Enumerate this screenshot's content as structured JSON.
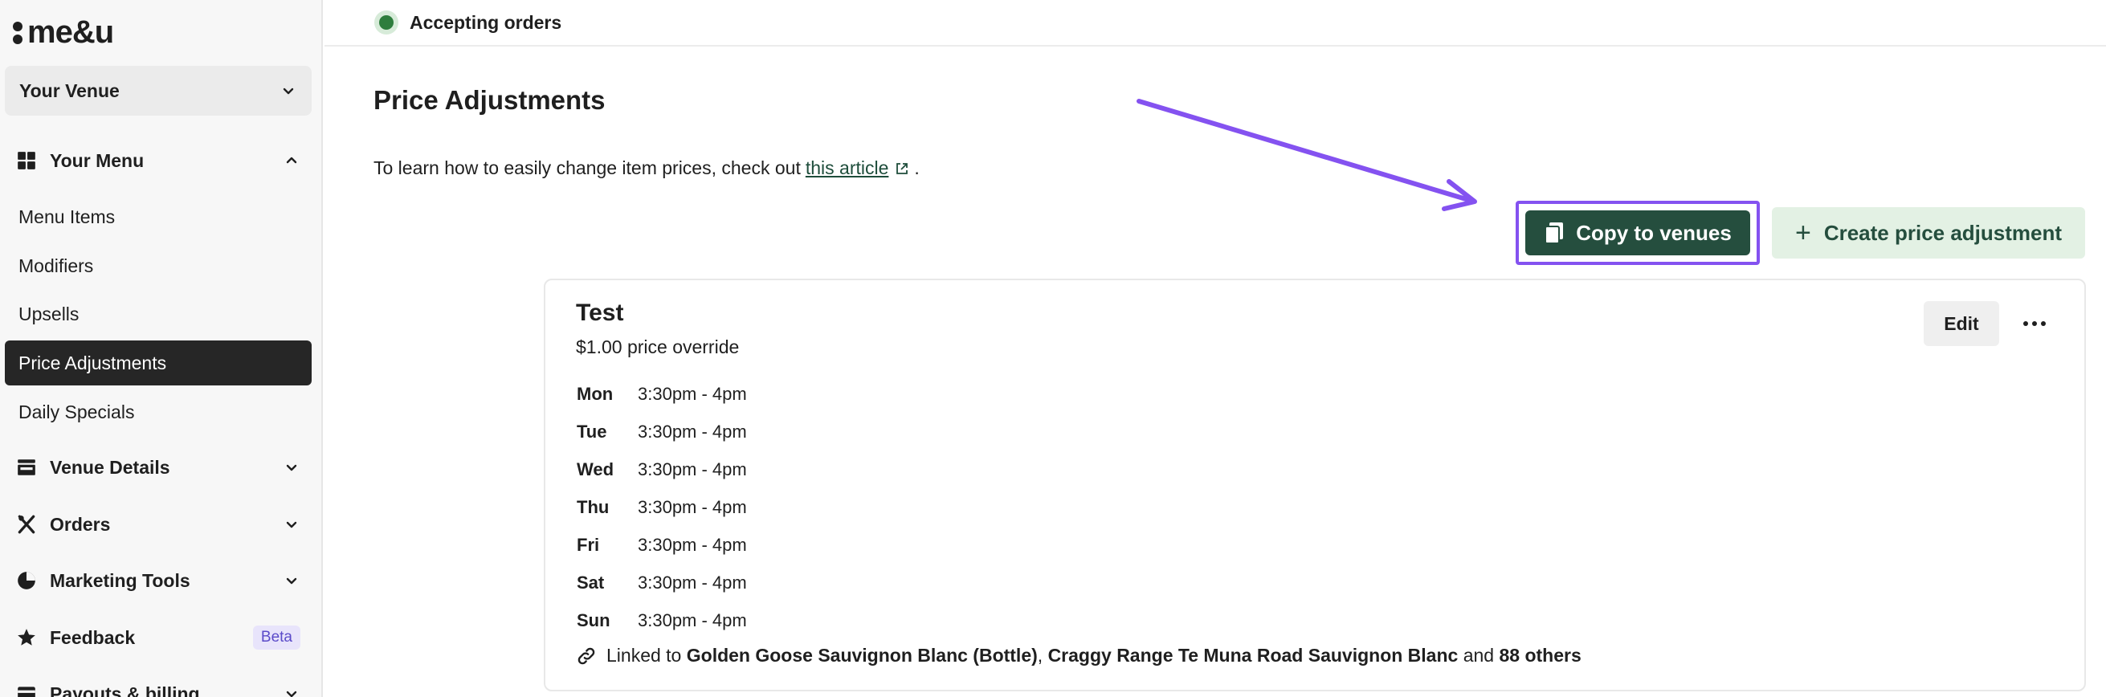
{
  "app": {
    "logo_text": "me&u"
  },
  "sidebar": {
    "venue_select": "Your Venue",
    "your_menu": "Your Menu",
    "menu_items": [
      {
        "label": "Menu Items"
      },
      {
        "label": "Modifiers"
      },
      {
        "label": "Upsells"
      },
      {
        "label": "Price Adjustments",
        "active": true
      },
      {
        "label": "Daily Specials"
      }
    ],
    "sections": [
      {
        "label": "Venue Details",
        "icon": "storefront-icon"
      },
      {
        "label": "Orders",
        "icon": "cutlery-icon"
      },
      {
        "label": "Marketing Tools",
        "icon": "pie-chart-icon"
      },
      {
        "label": "Feedback",
        "icon": "star-icon",
        "badge": "Beta"
      },
      {
        "label": "Payouts & billing",
        "icon": "card-icon"
      }
    ]
  },
  "status": {
    "label": "Accepting orders",
    "color": "#2e7d3d"
  },
  "page": {
    "title": "Price Adjustments",
    "help_prefix": "To learn how to easily change item prices, check out",
    "help_link": "this article",
    "help_suffix": "."
  },
  "actions": {
    "copy_label": "Copy to venues",
    "create_label": "Create price adjustment"
  },
  "adjustment": {
    "title": "Test",
    "subtitle": "$1.00 price override",
    "edit_label": "Edit",
    "schedule": [
      {
        "day": "Mon",
        "time": "3:30pm - 4pm"
      },
      {
        "day": "Tue",
        "time": "3:30pm - 4pm"
      },
      {
        "day": "Wed",
        "time": "3:30pm - 4pm"
      },
      {
        "day": "Thu",
        "time": "3:30pm - 4pm"
      },
      {
        "day": "Fri",
        "time": "3:30pm - 4pm"
      },
      {
        "day": "Sat",
        "time": "3:30pm - 4pm"
      },
      {
        "day": "Sun",
        "time": "3:30pm - 4pm"
      }
    ],
    "linked_prefix": "Linked to",
    "linked_item_1": "Golden Goose Sauvignon Blanc (Bottle)",
    "linked_sep": ",",
    "linked_item_2": "Craggy Range Te Muna Road Sauvignon Blanc",
    "linked_and": "and",
    "linked_others": "88 others"
  },
  "colors": {
    "brand_green": "#254e3e",
    "highlight_purple": "#8452f0",
    "light_green": "#e3f1e4"
  }
}
